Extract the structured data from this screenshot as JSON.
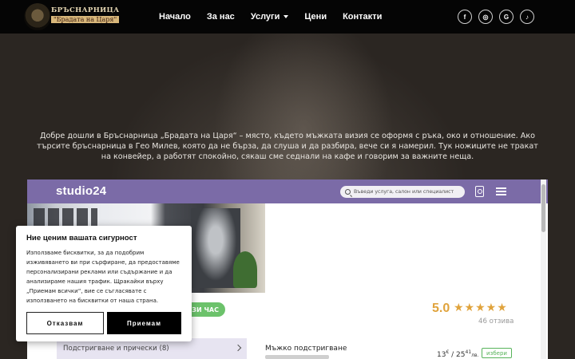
{
  "header": {
    "logo": {
      "line1": "БРЪСНАРНИЦА",
      "line2": "\"Брадата на Царя\""
    },
    "nav": [
      {
        "label": "Начало"
      },
      {
        "label": "За нас"
      },
      {
        "label": "Услуги",
        "has_dropdown": true
      },
      {
        "label": "Цени"
      },
      {
        "label": "Контакти"
      }
    ],
    "socials": [
      {
        "icon": "facebook-icon",
        "glyph": "f"
      },
      {
        "icon": "instagram-icon",
        "glyph": "◎"
      },
      {
        "icon": "google-icon",
        "glyph": "G"
      },
      {
        "icon": "tiktok-icon",
        "glyph": "♪"
      }
    ]
  },
  "hero": {
    "welcome_text": "Добре дошли в Бръснарница „Брадата на Царя“ – място, където мъжката визия се оформя с ръка, око и отношение. Ако търсите бръснарница в Гео Милев, която да не бърза, да слуша и да разбира, вече си я намерил. Тук ножиците не тракат на конвейер, а работят спокойно, сякаш сме седнали на кафе и говорим за важните неща."
  },
  "widget": {
    "brand": "studio24",
    "search_placeholder": "Въведи услуга, салон или специалист",
    "book_button": "ЗИ ЧАС",
    "rating": "5.0",
    "stars": "★★★★★",
    "reviews": "46 отзива",
    "category": "Подстригване и прически (8)",
    "service": {
      "name": "Мъжко подстригване",
      "price_from": "13",
      "price_from_cents": "€",
      "price_to": "25",
      "price_to_cents": "41",
      "currency": "лв.",
      "choose": "избери"
    }
  },
  "cookie": {
    "title": "Ние ценим вашата сигурност",
    "body": "Използваме бисквитки, за да подобрим изживяването ви при сърфиране, да предоставяме персонализирани реклами или съдържание и да анализираме нашия трафик. Щракайки върху „Приемам всички“, вие се съгласявате с използването на бисквитки от наша страна.",
    "reject": "Отказвам",
    "accept": "Приемам"
  },
  "colors": {
    "topbar": "#050505",
    "widget_header": "#7b6ba7",
    "rating": "#e0a33c",
    "accent_green": "#6cc26b"
  }
}
